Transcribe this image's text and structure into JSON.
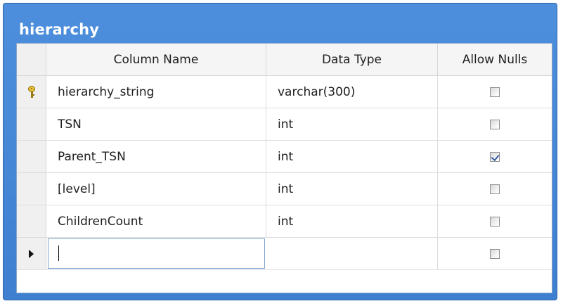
{
  "table": {
    "title": "hierarchy"
  },
  "columns": {
    "name": "Column Name",
    "type": "Data Type",
    "nulls": "Allow Nulls"
  },
  "rows": [
    {
      "name": "hierarchy_string",
      "type": "varchar(300)",
      "allow_nulls": false,
      "primary_key": true
    },
    {
      "name": "TSN",
      "type": "int",
      "allow_nulls": false,
      "primary_key": false
    },
    {
      "name": "Parent_TSN",
      "type": "int",
      "allow_nulls": true,
      "primary_key": false
    },
    {
      "name": "[level]",
      "type": "int",
      "allow_nulls": false,
      "primary_key": false
    },
    {
      "name": "ChildrenCount",
      "type": "int",
      "allow_nulls": false,
      "primary_key": false
    }
  ],
  "new_row": {
    "name": "",
    "type": "",
    "allow_nulls": false
  },
  "icons": {
    "primary_key": "key-icon",
    "current_row": "row-arrow-icon"
  },
  "colors": {
    "title_bar": "#4d8fdc",
    "checkmark": "#3b5fa8",
    "key": "#e8c33a"
  }
}
